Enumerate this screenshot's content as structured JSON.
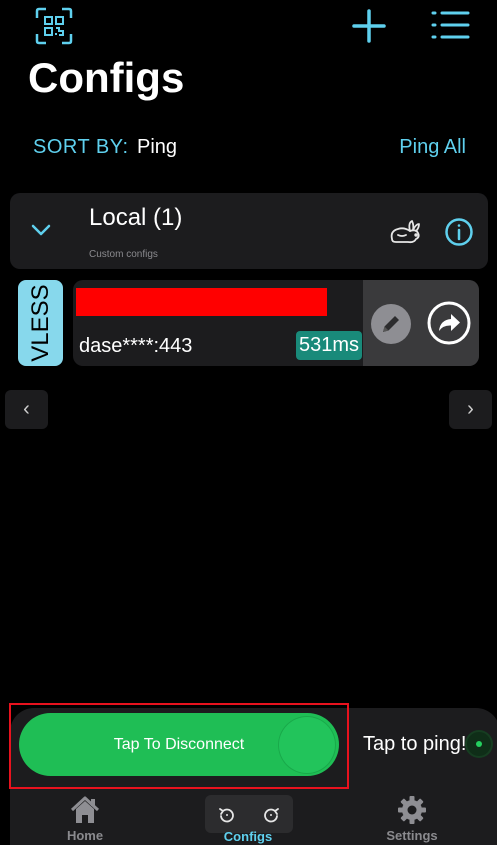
{
  "header": {
    "title": "Configs",
    "icons": {
      "scan": "qr-scan-icon",
      "add": "plus-icon",
      "menu": "list-menu-icon"
    }
  },
  "sort": {
    "label": "SORT BY:",
    "value": "Ping",
    "ping_all": "Ping All"
  },
  "group": {
    "name": "Local (1)",
    "subtitle": "Custom configs",
    "expanded": true,
    "icons": [
      "chevron-down-icon",
      "rabbit-icon",
      "info-icon"
    ]
  },
  "config": {
    "protocol": "VLESS",
    "name_redacted": true,
    "address": "dase****:443",
    "ping": "531ms",
    "actions": [
      "pencil-icon",
      "share-arrow-icon"
    ]
  },
  "pager": {
    "prev": "‹",
    "next": "›"
  },
  "connect": {
    "label": "Tap To Disconnect",
    "ping_hint": "Tap to ping!"
  },
  "tabs": [
    {
      "label": "Home",
      "icon": "home-icon",
      "active": false
    },
    {
      "label": "Configs",
      "icon": "undo-redo-icon",
      "active": true
    },
    {
      "label": "Settings",
      "icon": "gear-icon",
      "active": false
    }
  ],
  "colors": {
    "accent": "#5fd0ee",
    "connect_green": "#1fbe55",
    "ping_badge": "#198a7a",
    "protocol_tag": "#87d8ec",
    "redaction": "#ff0000",
    "highlight": "#e8121e"
  }
}
